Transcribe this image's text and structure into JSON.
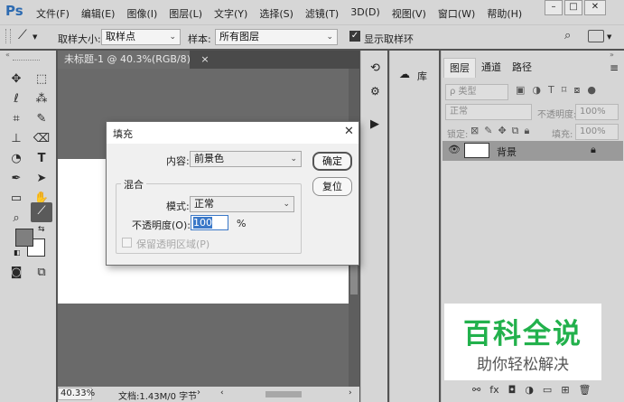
{
  "app": {
    "logo": "Ps"
  },
  "menubar": {
    "items": [
      "文件(F)",
      "编辑(E)",
      "图像(I)",
      "图层(L)",
      "文字(Y)",
      "选择(S)",
      "滤镜(T)",
      "3D(D)",
      "视图(V)",
      "窗口(W)",
      "帮助(H)"
    ],
    "window_controls": [
      "–",
      "□",
      "✕"
    ]
  },
  "options": {
    "sample_size_label": "取样大小:",
    "sample_size_value": "取样点",
    "sample_label": "样本:",
    "sample_value": "所有图层",
    "show_ring_label": "显示取样环",
    "show_ring_checked": true
  },
  "document": {
    "tab_title": "未标题-1 @ 40.3%(RGB/8)",
    "tab_close": "×",
    "zoom": "40.33%",
    "doc_info": "文档:1.43M/0 字节"
  },
  "library": {
    "label": "库"
  },
  "layers_panel": {
    "tabs": [
      "图层",
      "通道",
      "路径"
    ],
    "filter_placeholder": "ρ 类型",
    "blend_mode": "正常",
    "opacity_label": "不透明度:",
    "opacity_value": "100%",
    "lock_label": "锁定:",
    "fill_label": "填充:",
    "fill_value": "100%",
    "layers": [
      {
        "name": "背景",
        "visible": true,
        "locked": true
      }
    ],
    "footer_icons": [
      "link-icon",
      "fx-icon",
      "mask-icon",
      "adjustment-icon",
      "folder-icon",
      "new-layer-icon",
      "trash-icon"
    ]
  },
  "dialog": {
    "title": "填充",
    "close": "✕",
    "content_label": "内容:",
    "content_value": "前景色",
    "ok_label": "确定",
    "reset_label": "复位",
    "blend_group_label": "混合",
    "mode_label": "模式:",
    "mode_value": "正常",
    "opacity_label": "不透明度(O):",
    "opacity_value": "100",
    "opacity_unit": "%",
    "preserve_label": "保留透明区域(P)",
    "preserve_checked": false,
    "preserve_enabled": false
  },
  "watermark": {
    "title": "百科全说",
    "subtitle": "助你轻松解决"
  },
  "colors": {
    "ui_gray": "#d6d6d6",
    "canvas_bg": "#6a6a6a",
    "foreground": "#7f7f7f",
    "background": "#ffffff",
    "accent_blue": "#3a78c8",
    "watermark_green": "#22b14c"
  }
}
